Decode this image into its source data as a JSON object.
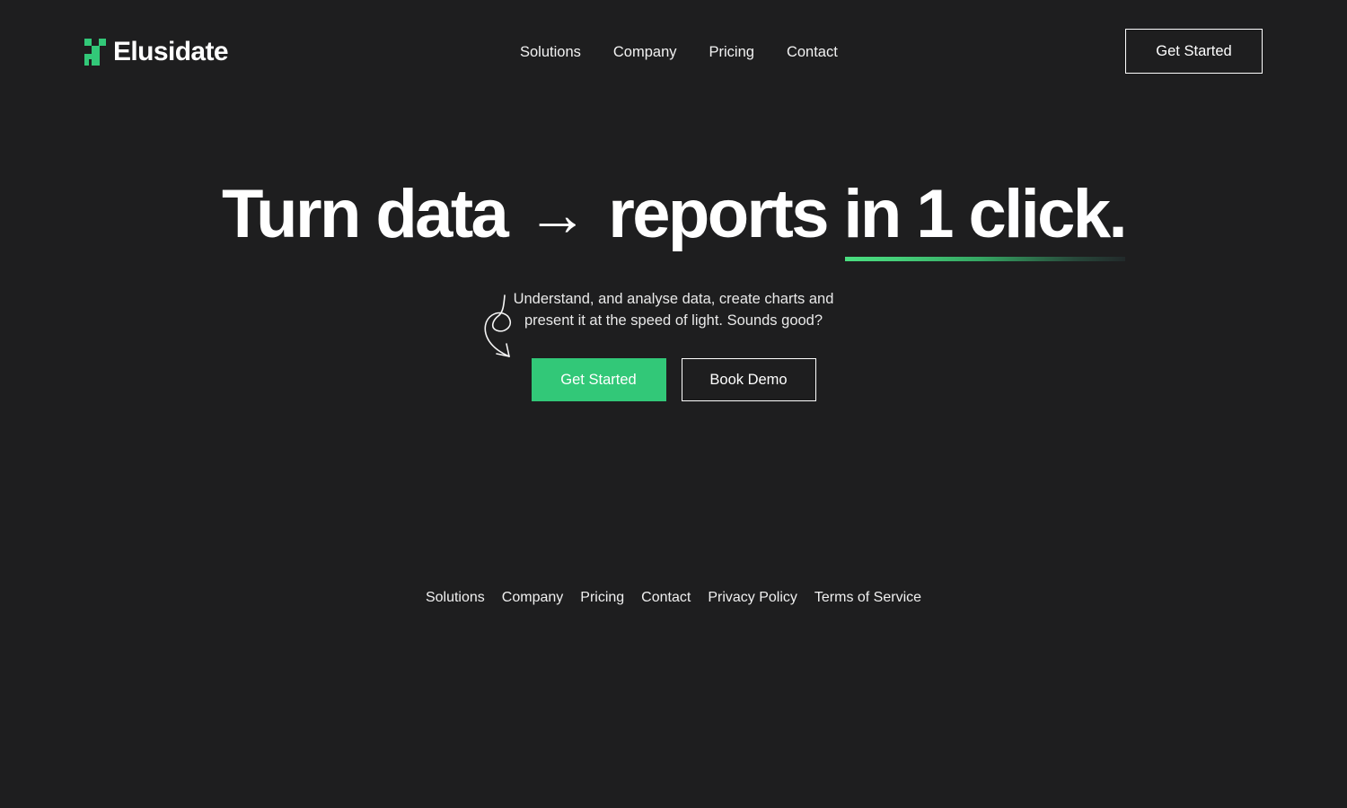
{
  "theme": {
    "background": "#1e1e1f",
    "accent_green": "#32c878",
    "underline_green": "#4ade80",
    "text": "#ffffff"
  },
  "header": {
    "brand_name": "Elusidate",
    "logo_icon": "pixel-blocks-logo-icon",
    "nav": [
      {
        "label": "Solutions"
      },
      {
        "label": "Company"
      },
      {
        "label": "Pricing"
      },
      {
        "label": "Contact"
      }
    ],
    "cta_label": "Get Started"
  },
  "hero": {
    "headline_part1": "Turn data",
    "headline_arrow": "→",
    "headline_part2": "reports",
    "headline_emphasis": "in 1 click.",
    "subhead_line1": "Understand, and analyse data, create charts and",
    "subhead_line2": "present it at the speed of light. Sounds good?",
    "primary_cta_label": "Get Started",
    "secondary_cta_label": "Book Demo",
    "doodle_icon": "hand-drawn-curly-arrow-icon"
  },
  "footer": {
    "links": [
      {
        "label": "Solutions"
      },
      {
        "label": "Company"
      },
      {
        "label": "Pricing"
      },
      {
        "label": "Contact"
      },
      {
        "label": "Privacy Policy"
      },
      {
        "label": "Terms of Service"
      }
    ]
  }
}
